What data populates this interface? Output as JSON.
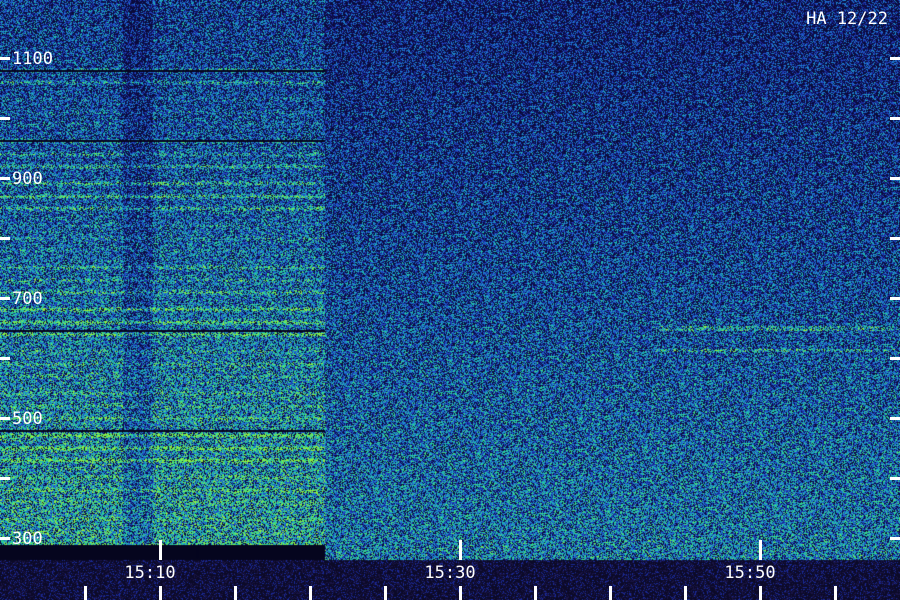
{
  "chart_data": {
    "type": "heatmap",
    "title": "HA 12/22",
    "xlabel": "",
    "ylabel": "",
    "x_unit": "time (HH:MM)",
    "x_range": [
      "15:03",
      "15:53"
    ],
    "x_tick_labels": [
      "15:10",
      "15:30",
      "15:50"
    ],
    "x_tick_values_min": [
      10,
      30,
      50
    ],
    "x_minor_tick_step_min": 5,
    "y_range": [
      400,
      1200
    ],
    "y_tick_labels": [
      "1100",
      "900",
      "700",
      "500",
      "300"
    ],
    "y_tick_values": [
      1100,
      900,
      700,
      500,
      300
    ],
    "colormap": [
      "#10105a",
      "#1a2a9a",
      "#2050c8",
      "#1e88d0",
      "#20c0b0",
      "#40e080",
      "#90f040"
    ],
    "background_color": "#0a0a3a",
    "regions": [
      {
        "label": "banded emission",
        "x_start": "15:00",
        "x_end": "15:21",
        "intensity": "high"
      },
      {
        "label": "noise",
        "x_start": "15:21",
        "x_end": "15:53",
        "intensity": "low"
      }
    ],
    "grid": false
  }
}
